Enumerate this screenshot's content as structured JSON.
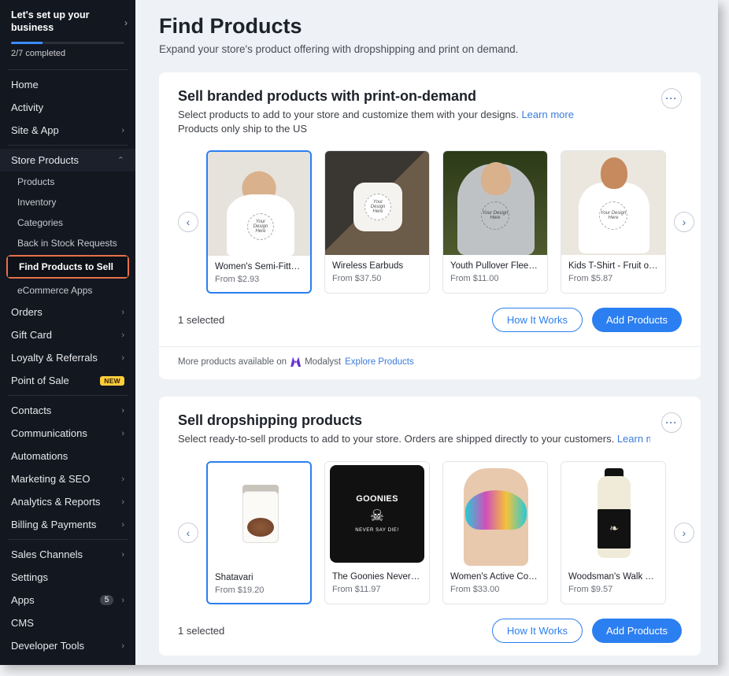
{
  "sidebar": {
    "setup": {
      "title": "Let's set up your business",
      "progress_text": "2/7 completed"
    },
    "nav1": [
      {
        "label": "Home",
        "chev": false
      },
      {
        "label": "Activity",
        "chev": false
      },
      {
        "label": "Site & App",
        "chev": true
      }
    ],
    "store_products_label": "Store Products",
    "store_subs": [
      "Products",
      "Inventory",
      "Categories",
      "Back in Stock Requests"
    ],
    "active_sub": "Find Products to Sell",
    "after_active_sub": "eCommerce Apps",
    "nav2": [
      {
        "label": "Orders",
        "chev": true
      },
      {
        "label": "Gift Card",
        "chev": true
      },
      {
        "label": "Loyalty & Referrals",
        "chev": true
      },
      {
        "label": "Point of Sale",
        "chev": false,
        "new": true
      }
    ],
    "nav3": [
      {
        "label": "Contacts",
        "chev": true
      },
      {
        "label": "Communications",
        "chev": true
      },
      {
        "label": "Automations",
        "chev": false
      },
      {
        "label": "Marketing & SEO",
        "chev": true
      },
      {
        "label": "Analytics & Reports",
        "chev": true
      },
      {
        "label": "Billing & Payments",
        "chev": true
      }
    ],
    "nav4": [
      {
        "label": "Sales Channels",
        "chev": true
      },
      {
        "label": "Settings",
        "chev": false
      },
      {
        "label": "Apps",
        "chev": true,
        "count": "5"
      },
      {
        "label": "CMS",
        "chev": false
      },
      {
        "label": "Developer Tools",
        "chev": true
      }
    ]
  },
  "page": {
    "title": "Find Products",
    "subtitle": "Expand your store's product offering with dropshipping and print on demand."
  },
  "pod": {
    "title": "Sell branded products with print-on-demand",
    "desc_1": "Select products to add to your store and customize them with your designs. ",
    "learn_more": "Learn more",
    "desc_2": "Products only ship to the US",
    "design_placeholder": "Your Design Here",
    "products": [
      {
        "name": "Women's Semi-Fitted …",
        "price": "From $2.93",
        "selected": true
      },
      {
        "name": "Wireless Earbuds",
        "price": "From $37.50",
        "selected": false
      },
      {
        "name": "Youth Pullover Fleece …",
        "price": "From $11.00",
        "selected": false
      },
      {
        "name": "Kids T-Shirt - Fruit of t…",
        "price": "From $5.87",
        "selected": false
      }
    ],
    "selected_text": "1 selected",
    "how_it_works": "How It Works",
    "add_products": "Add Products",
    "more_line": "More products available on",
    "modalyst": "Modalyst",
    "explore": "Explore Products"
  },
  "ds": {
    "title": "Sell dropshipping products",
    "desc_1": "Select ready-to-sell products to add to your store. Orders are shipped directly to your customers. ",
    "learn_more": "Learn mo",
    "products": [
      {
        "name": "Shatavari",
        "price": "From $19.20",
        "selected": true
      },
      {
        "name": "The Goonies Never Sa…",
        "price": "From $11.97",
        "selected": false
      },
      {
        "name": "Women's Active Comf…",
        "price": "From $33.00",
        "selected": false
      },
      {
        "name": "Woodsman's Walk Bea…",
        "price": "From $9.57",
        "selected": false
      }
    ],
    "goonies_top": "GOONIES",
    "goonies_bottom": "NEVER SAY DIE!",
    "selected_text": "1 selected",
    "how_it_works": "How It Works",
    "add_products": "Add Products"
  }
}
